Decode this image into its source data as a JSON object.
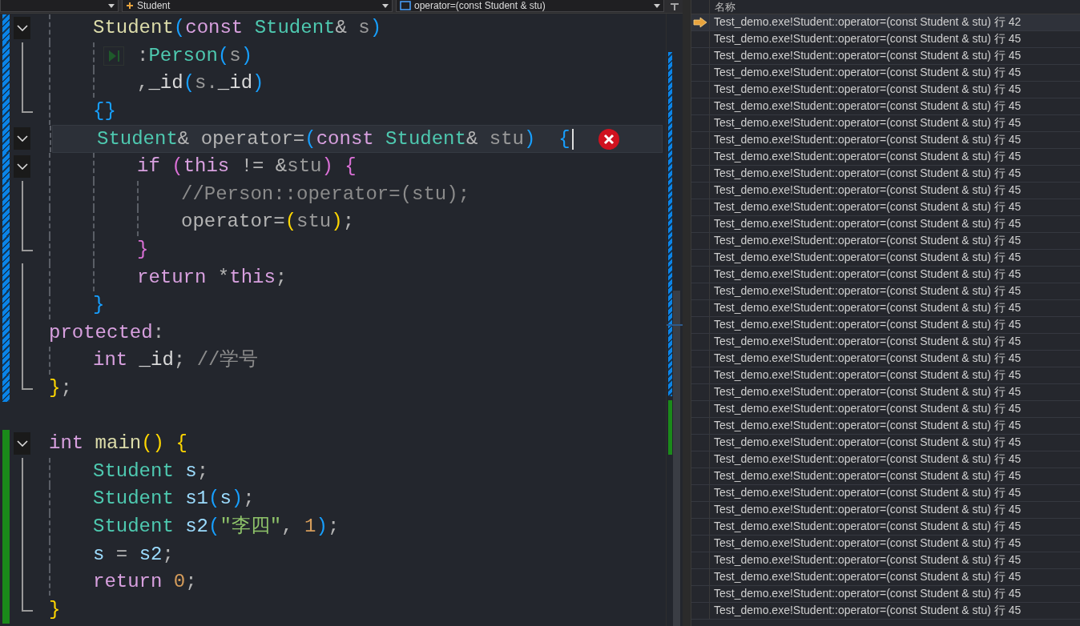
{
  "toolbar": {
    "class_dropdown": "Student",
    "member_dropdown": "operator=(const Student & stu)"
  },
  "editor": {
    "lines": [
      {
        "color": "#0a84e8",
        "kind": "fold-start",
        "cursor": false,
        "error": false,
        "run_to_click": false,
        "tokens": [
          {
            "text": "    Student",
            "color": "#dcdcaa"
          },
          {
            "text": "(",
            "color": "#179fff"
          },
          {
            "text": "const ",
            "color": "#d8a0df"
          },
          {
            "text": "Student",
            "color": "#4ec9b0"
          },
          {
            "text": "& ",
            "color": "#b4b4b4"
          },
          {
            "text": "s",
            "color": "#9a9a9a"
          },
          {
            "text": ")",
            "color": "#179fff"
          }
        ]
      },
      {
        "color": "#0a84e8",
        "kind": "fold-inner",
        "cursor": false,
        "error": false,
        "run_to_click": true,
        "tokens": [
          {
            "text": "        :",
            "color": "#b4b4b4"
          },
          {
            "text": "Person",
            "color": "#4ec9b0"
          },
          {
            "text": "(",
            "color": "#179fff"
          },
          {
            "text": "s",
            "color": "#9a9a9a"
          },
          {
            "text": ")",
            "color": "#179fff"
          }
        ]
      },
      {
        "color": "#0a84e8",
        "kind": "fold-inner",
        "cursor": false,
        "error": false,
        "run_to_click": false,
        "tokens": [
          {
            "text": "        ,",
            "color": "#b4b4b4"
          },
          {
            "text": "_id",
            "color": "#dadada"
          },
          {
            "text": "(",
            "color": "#179fff"
          },
          {
            "text": "s.",
            "color": "#9a9a9a"
          },
          {
            "text": "_id",
            "color": "#dadada"
          },
          {
            "text": ")",
            "color": "#179fff"
          }
        ]
      },
      {
        "color": "#0a84e8",
        "kind": "fold-end",
        "cursor": false,
        "error": false,
        "run_to_click": false,
        "tokens": [
          {
            "text": "    {}",
            "color": "#179fff"
          }
        ]
      },
      {
        "color": "#0a84e8",
        "kind": "fold-start",
        "cursor": true,
        "error": true,
        "run_to_click": false,
        "tokens": [
          {
            "text": "    Student",
            "color": "#4ec9b0"
          },
          {
            "text": "& operator=",
            "color": "#b4b4b4"
          },
          {
            "text": "(",
            "color": "#179fff"
          },
          {
            "text": "const ",
            "color": "#d8a0df"
          },
          {
            "text": "Student",
            "color": "#4ec9b0"
          },
          {
            "text": "& ",
            "color": "#b4b4b4"
          },
          {
            "text": "stu",
            "color": "#9a9a9a"
          },
          {
            "text": ")  {",
            "color": "#179fff"
          }
        ]
      },
      {
        "color": "#0a84e8",
        "kind": "fold-start",
        "cursor": false,
        "error": false,
        "run_to_click": false,
        "tokens": [
          {
            "text": "        if ",
            "color": "#d8a0df"
          },
          {
            "text": "(",
            "color": "#da70d6"
          },
          {
            "text": "this",
            "color": "#d8a0df"
          },
          {
            "text": " != &",
            "color": "#b4b4b4"
          },
          {
            "text": "stu",
            "color": "#9a9a9a"
          },
          {
            "text": ") {",
            "color": "#da70d6"
          }
        ]
      },
      {
        "color": "#0a84e8",
        "kind": "fold-inner",
        "cursor": false,
        "error": false,
        "run_to_click": false,
        "tokens": [
          {
            "text": "            //Person::operator=(stu);",
            "color": "#8b8b8b"
          }
        ]
      },
      {
        "color": "#0a84e8",
        "kind": "fold-inner",
        "cursor": false,
        "error": false,
        "run_to_click": false,
        "tokens": [
          {
            "text": "            operator=",
            "color": "#b4b4b4"
          },
          {
            "text": "(",
            "color": "#ffd700"
          },
          {
            "text": "stu",
            "color": "#9a9a9a"
          },
          {
            "text": ")",
            "color": "#ffd700"
          },
          {
            "text": ";",
            "color": "#b4b4b4"
          }
        ]
      },
      {
        "color": "#0a84e8",
        "kind": "fold-end",
        "cursor": false,
        "error": false,
        "run_to_click": false,
        "tokens": [
          {
            "text": "        }",
            "color": "#da70d6"
          }
        ]
      },
      {
        "color": "#0a84e8",
        "kind": "fold-inner",
        "cursor": false,
        "error": false,
        "run_to_click": false,
        "tokens": [
          {
            "text": "        return ",
            "color": "#d8a0df"
          },
          {
            "text": "*",
            "color": "#b4b4b4"
          },
          {
            "text": "this",
            "color": "#d8a0df"
          },
          {
            "text": ";",
            "color": "#b4b4b4"
          }
        ]
      },
      {
        "color": "#0a84e8",
        "kind": "fold-inner",
        "cursor": false,
        "error": false,
        "run_to_click": false,
        "tokens": [
          {
            "text": "    }",
            "color": "#179fff"
          }
        ]
      },
      {
        "color": "#0a84e8",
        "kind": "fold-inner",
        "cursor": false,
        "error": false,
        "run_to_click": false,
        "tokens": [
          {
            "text": "protected",
            "color": "#d8a0df"
          },
          {
            "text": ":",
            "color": "#b4b4b4"
          }
        ]
      },
      {
        "color": "#0a84e8",
        "kind": "fold-inner",
        "cursor": false,
        "error": false,
        "run_to_click": false,
        "tokens": [
          {
            "text": "    int ",
            "color": "#d8a0df"
          },
          {
            "text": "_id",
            "color": "#dadada"
          },
          {
            "text": "; ",
            "color": "#b4b4b4"
          },
          {
            "text": "//学号",
            "color": "#8b8b8b"
          }
        ]
      },
      {
        "color": "#0a84e8",
        "kind": "fold-end",
        "cursor": false,
        "error": false,
        "run_to_click": false,
        "tokens": [
          {
            "text": "}",
            "color": "#ffd700"
          },
          {
            "text": ";",
            "color": "#b4b4b4"
          }
        ]
      },
      {
        "kind": "blank",
        "cursor": false,
        "error": false,
        "run_to_click": false
      },
      {
        "color": "#1a8a1a",
        "kind": "fold-start",
        "cursor": false,
        "error": false,
        "run_to_click": false,
        "tokens": [
          {
            "text": "int ",
            "color": "#d8a0df"
          },
          {
            "text": "main",
            "color": "#dcdcaa"
          },
          {
            "text": "()",
            "color": "#ffd700"
          },
          {
            "text": " {",
            "color": "#ffd700"
          }
        ]
      },
      {
        "color": "#1a8a1a",
        "kind": "fold-inner",
        "cursor": false,
        "error": false,
        "run_to_click": false,
        "tokens": [
          {
            "text": "    Student ",
            "color": "#4ec9b0"
          },
          {
            "text": "s",
            "color": "#9cdcfe"
          },
          {
            "text": ";",
            "color": "#b4b4b4"
          }
        ]
      },
      {
        "color": "#1a8a1a",
        "kind": "fold-inner",
        "cursor": false,
        "error": false,
        "run_to_click": false,
        "tokens": [
          {
            "text": "    Student ",
            "color": "#4ec9b0"
          },
          {
            "text": "s1",
            "color": "#9cdcfe"
          },
          {
            "text": "(",
            "color": "#179fff"
          },
          {
            "text": "s",
            "color": "#9cdcfe"
          },
          {
            "text": ")",
            "color": "#179fff"
          },
          {
            "text": ";",
            "color": "#b4b4b4"
          }
        ]
      },
      {
        "color": "#1a8a1a",
        "kind": "fold-inner",
        "cursor": false,
        "error": false,
        "run_to_click": false,
        "tokens": [
          {
            "text": "    Student ",
            "color": "#4ec9b0"
          },
          {
            "text": "s2",
            "color": "#9cdcfe"
          },
          {
            "text": "(",
            "color": "#179fff"
          },
          {
            "text": "\"李四\"",
            "color": "#8fc46a"
          },
          {
            "text": ", ",
            "color": "#b4b4b4"
          },
          {
            "text": "1",
            "color": "#d69d5b"
          },
          {
            "text": ")",
            "color": "#179fff"
          },
          {
            "text": ";",
            "color": "#b4b4b4"
          }
        ]
      },
      {
        "color": "#1a8a1a",
        "kind": "fold-inner",
        "cursor": false,
        "error": false,
        "run_to_click": false,
        "tokens": [
          {
            "text": "    s ",
            "color": "#9cdcfe"
          },
          {
            "text": "= ",
            "color": "#b4b4b4"
          },
          {
            "text": "s2",
            "color": "#9cdcfe"
          },
          {
            "text": ";",
            "color": "#b4b4b4"
          }
        ]
      },
      {
        "color": "#1a8a1a",
        "kind": "fold-inner",
        "cursor": false,
        "error": false,
        "run_to_click": false,
        "tokens": [
          {
            "text": "    return ",
            "color": "#d8a0df"
          },
          {
            "text": "0",
            "color": "#d69d5b"
          },
          {
            "text": ";",
            "color": "#b4b4b4"
          }
        ]
      },
      {
        "color": "#1a8a1a",
        "kind": "fold-end",
        "cursor": false,
        "error": false,
        "run_to_click": false,
        "tokens": [
          {
            "text": "}",
            "color": "#ffd700"
          }
        ]
      }
    ]
  },
  "call_stack": {
    "header": "名称",
    "frames": [
      {
        "text": "Test_demo.exe!Student::operator=(const Student & stu) 行 42",
        "current": true
      },
      {
        "text": "Test_demo.exe!Student::operator=(const Student & stu) 行 45",
        "current": false
      },
      {
        "text": "Test_demo.exe!Student::operator=(const Student & stu) 行 45",
        "current": false
      },
      {
        "text": "Test_demo.exe!Student::operator=(const Student & stu) 行 45",
        "current": false
      },
      {
        "text": "Test_demo.exe!Student::operator=(const Student & stu) 行 45",
        "current": false
      },
      {
        "text": "Test_demo.exe!Student::operator=(const Student & stu) 行 45",
        "current": false
      },
      {
        "text": "Test_demo.exe!Student::operator=(const Student & stu) 行 45",
        "current": false
      },
      {
        "text": "Test_demo.exe!Student::operator=(const Student & stu) 行 45",
        "current": false
      },
      {
        "text": "Test_demo.exe!Student::operator=(const Student & stu) 行 45",
        "current": false
      },
      {
        "text": "Test_demo.exe!Student::operator=(const Student & stu) 行 45",
        "current": false
      },
      {
        "text": "Test_demo.exe!Student::operator=(const Student & stu) 行 45",
        "current": false
      },
      {
        "text": "Test_demo.exe!Student::operator=(const Student & stu) 行 45",
        "current": false
      },
      {
        "text": "Test_demo.exe!Student::operator=(const Student & stu) 行 45",
        "current": false
      },
      {
        "text": "Test_demo.exe!Student::operator=(const Student & stu) 行 45",
        "current": false
      },
      {
        "text": "Test_demo.exe!Student::operator=(const Student & stu) 行 45",
        "current": false
      },
      {
        "text": "Test_demo.exe!Student::operator=(const Student & stu) 行 45",
        "current": false
      },
      {
        "text": "Test_demo.exe!Student::operator=(const Student & stu) 行 45",
        "current": false
      },
      {
        "text": "Test_demo.exe!Student::operator=(const Student & stu) 行 45",
        "current": false
      },
      {
        "text": "Test_demo.exe!Student::operator=(const Student & stu) 行 45",
        "current": false
      },
      {
        "text": "Test_demo.exe!Student::operator=(const Student & stu) 行 45",
        "current": false
      },
      {
        "text": "Test_demo.exe!Student::operator=(const Student & stu) 行 45",
        "current": false
      },
      {
        "text": "Test_demo.exe!Student::operator=(const Student & stu) 行 45",
        "current": false
      },
      {
        "text": "Test_demo.exe!Student::operator=(const Student & stu) 行 45",
        "current": false
      },
      {
        "text": "Test_demo.exe!Student::operator=(const Student & stu) 行 45",
        "current": false
      },
      {
        "text": "Test_demo.exe!Student::operator=(const Student & stu) 行 45",
        "current": false
      },
      {
        "text": "Test_demo.exe!Student::operator=(const Student & stu) 行 45",
        "current": false
      },
      {
        "text": "Test_demo.exe!Student::operator=(const Student & stu) 行 45",
        "current": false
      },
      {
        "text": "Test_demo.exe!Student::operator=(const Student & stu) 行 45",
        "current": false
      },
      {
        "text": "Test_demo.exe!Student::operator=(const Student & stu) 行 45",
        "current": false
      },
      {
        "text": "Test_demo.exe!Student::operator=(const Student & stu) 行 45",
        "current": false
      },
      {
        "text": "Test_demo.exe!Student::operator=(const Student & stu) 行 45",
        "current": false
      },
      {
        "text": "Test_demo.exe!Student::operator=(const Student & stu) 行 45",
        "current": false
      },
      {
        "text": "Test_demo.exe!Student::operator=(const Student & stu) 行 45",
        "current": false
      },
      {
        "text": "Test_demo.exe!Student::operator=(const Student & stu) 行 45",
        "current": false
      },
      {
        "text": "Test_demo.exe!Student::operator=(const Student & stu) 行 45",
        "current": false
      },
      {
        "text": "Test_demo.exe!Student::operator=(const Student & stu) 行 45",
        "current": false
      }
    ]
  }
}
